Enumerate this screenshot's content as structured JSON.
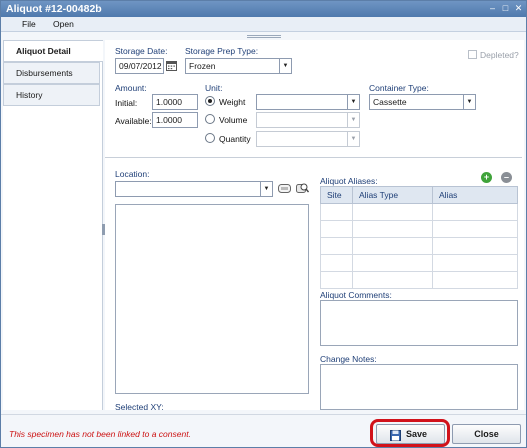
{
  "window": {
    "title": "Aliquot #12-00482b"
  },
  "menu": {
    "items": [
      {
        "label": "File"
      },
      {
        "label": "Open"
      }
    ]
  },
  "nav": {
    "items": [
      {
        "label": "Aliquot Detail"
      },
      {
        "label": "Disbursements"
      },
      {
        "label": "History"
      }
    ]
  },
  "form": {
    "storage_date_label": "Storage Date:",
    "storage_date_value": "09/07/2012",
    "storage_prep_label": "Storage Prep Type:",
    "storage_prep_value": "Frozen",
    "depleted_label": "Depleted?",
    "amount_label": "Amount:",
    "initial_label": "Initial:",
    "initial_value": "1.0000",
    "available_label": "Available:",
    "available_value": "1.0000",
    "unit_label": "Unit:",
    "unit_weight_label": "Weight",
    "unit_volume_label": "Volume",
    "unit_quantity_label": "Quantity",
    "container_type_label": "Container Type:",
    "container_type_value": "Cassette",
    "location_label": "Location:",
    "selected_xy_label": "Selected XY:",
    "aliquot_aliases_label": "Aliquot Aliases:",
    "aliases_columns": [
      "Site",
      "Alias Type",
      "Alias"
    ],
    "aliquot_comments_label": "Aliquot Comments:",
    "change_notes_label": "Change Notes:"
  },
  "footer": {
    "warning": "This specimen has not been linked to a consent.",
    "save_label": "Save",
    "close_label": "Close"
  },
  "colors": {
    "titlebar": "#5a82b5",
    "label_blue": "#1f3f77",
    "warning_red": "#cc1111",
    "highlight_ring": "#d1121b",
    "add_green": "#3fa33a",
    "remove_gray": "#8a8f96"
  },
  "icons": {
    "calendar": "calendar-icon",
    "location_picker": "location-picker-icon",
    "location_search": "location-search-icon",
    "add_alias": "add-icon",
    "remove_alias": "remove-icon",
    "save": "floppy-disk-icon"
  }
}
